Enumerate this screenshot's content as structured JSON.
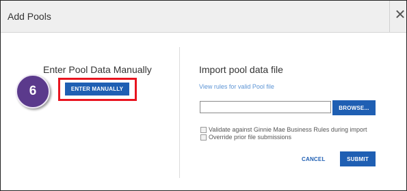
{
  "dialog": {
    "title": "Add Pools",
    "close_glyph": "✕"
  },
  "manual": {
    "heading": "Enter Pool Data Manually",
    "button_label": "ENTER MANUALLY",
    "step_number": "6",
    "highlight_color": "#e8141f",
    "badge_color": "#5b3a8c"
  },
  "import": {
    "heading": "Import pool data file",
    "rules_link": "View rules for valid Pool file",
    "file_value": "",
    "browse_label": "BROWSE...",
    "options": [
      {
        "label": "Validate against Ginnie Mae Business Rules during import",
        "checked": false
      },
      {
        "label": "Override prior file submissions",
        "checked": false
      }
    ],
    "cancel_label": "CANCEL",
    "submit_label": "SUBMIT"
  },
  "colors": {
    "primary_button": "#1f5fb3",
    "link": "#5b93d4"
  }
}
